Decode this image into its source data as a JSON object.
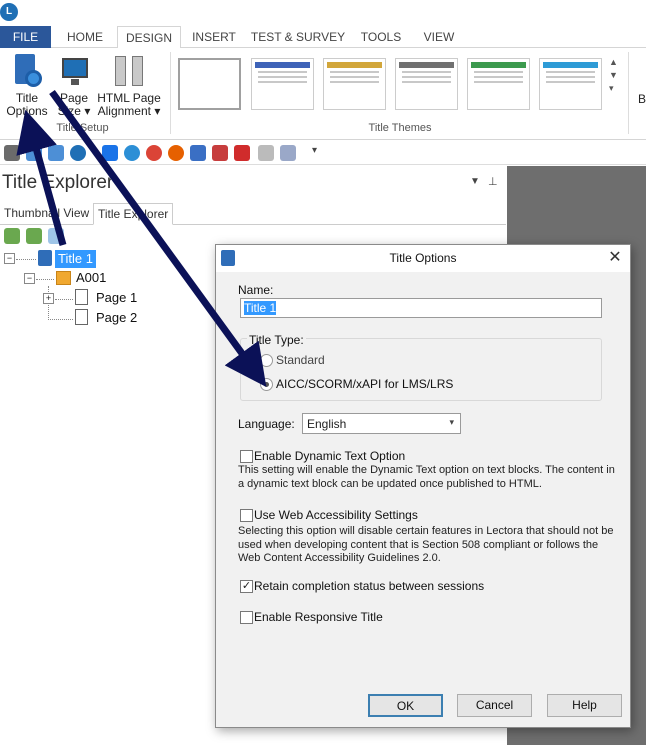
{
  "app": {
    "logo": "L"
  },
  "ribbon": {
    "tabs": [
      {
        "label": "FILE"
      },
      {
        "label": "HOME"
      },
      {
        "label": "DESIGN"
      },
      {
        "label": "INSERT"
      },
      {
        "label": "TEST & SURVEY"
      },
      {
        "label": "TOOLS"
      },
      {
        "label": "VIEW"
      }
    ],
    "buttons": {
      "title_options_line1": "Title",
      "title_options_line2": "Options",
      "page_size_line1": "Page",
      "page_size_line2": "Size",
      "alignment_line1": "HTML Page",
      "alignment_line2": "Alignment"
    },
    "groups": {
      "setup": "Title Setup",
      "themes": "Title Themes"
    },
    "overflow_label": "B",
    "theme_colors": [
      "#ffffff",
      "#3e63b8",
      "#d2a63a",
      "#707070",
      "#3c9a4e",
      "#2e9bd6"
    ]
  },
  "explorer": {
    "title": "Title Explorer",
    "tabs": [
      {
        "label": "Thumbnail View"
      },
      {
        "label": "Title Explorer"
      }
    ],
    "tree": {
      "root": "Title 1",
      "chapter": "A001",
      "pages": [
        "Page 1",
        "Page 2"
      ]
    }
  },
  "dialog": {
    "title": "Title Options",
    "name_label": "Name:",
    "name_value": "Title 1",
    "type_label": "Title Type:",
    "type_options": [
      "Standard",
      "AICC/SCORM/xAPI for LMS/LRS"
    ],
    "type_selected": 1,
    "language_label": "Language:",
    "language_value": "English",
    "dynamic_text": {
      "label": "Enable Dynamic Text Option",
      "checked": false,
      "desc": "This setting will enable the Dynamic Text option on text blocks. The content in a dynamic text block can be updated once published to HTML."
    },
    "accessibility": {
      "label": "Use Web Accessibility Settings",
      "checked": false,
      "desc": "Selecting this option will disable certain features in Lectora that should not be used when developing content that is Section 508 compliant or follows the Web Content Accessibility Guidelines 2.0."
    },
    "retain": {
      "label": "Retain completion status between sessions",
      "checked": true
    },
    "responsive": {
      "label": "Enable Responsive Title",
      "checked": false
    },
    "buttons": {
      "ok": "OK",
      "cancel": "Cancel",
      "help": "Help"
    }
  },
  "colors": {
    "accent": "#2b579a",
    "arrow": "#0b1157",
    "selection": "#3399ff"
  }
}
